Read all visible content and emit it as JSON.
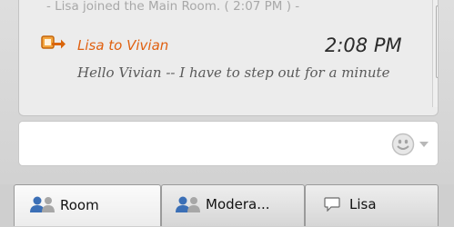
{
  "chat": {
    "system_message": "- Lisa joined the Main Room. ( 2:07 PM ) -",
    "message": {
      "sender": "Lisa to Vivian",
      "time": "2:08 PM",
      "text": "Hello Vivian -- I have to step out for a minute",
      "icon": "private-message-icon"
    }
  },
  "input": {
    "placeholder": "",
    "emoticon_icon": "smiley-icon"
  },
  "tabs": [
    {
      "label": "Room",
      "icon": "users-icon",
      "active": true
    },
    {
      "label": "Modera...",
      "icon": "users-icon",
      "active": false
    },
    {
      "label": "Lisa",
      "icon": "speech-bubble-icon",
      "active": false
    }
  ],
  "colors": {
    "sender": "#e06010",
    "icon_orange": "#e8891e",
    "people_blue": "#3b6fb6",
    "system_text": "#a8a8a8"
  }
}
